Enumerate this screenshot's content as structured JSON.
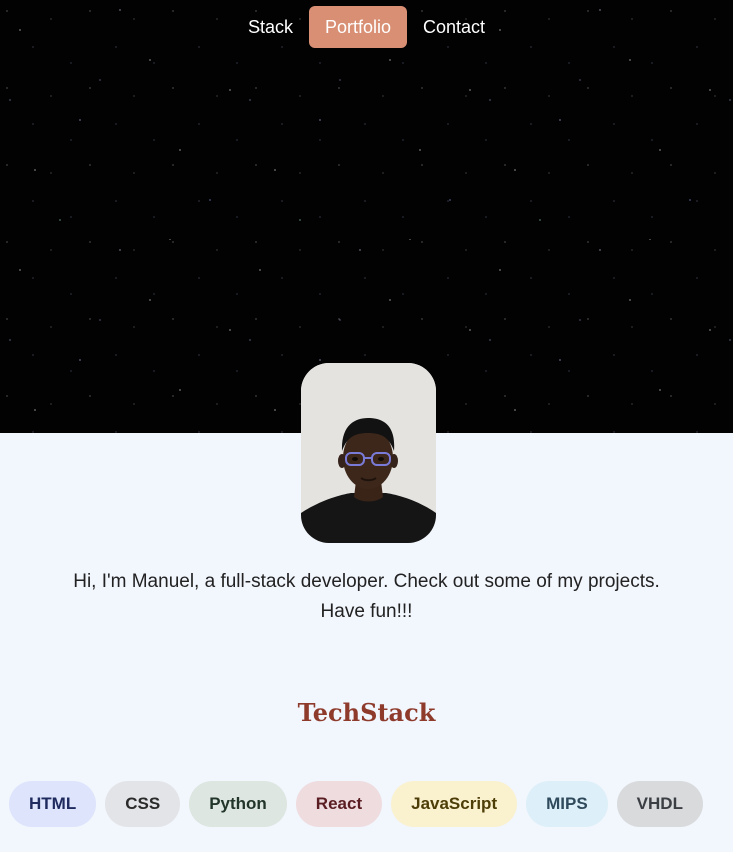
{
  "nav": {
    "items": [
      {
        "label": "Stack",
        "active": false
      },
      {
        "label": "Portfolio",
        "active": true
      },
      {
        "label": "Contact",
        "active": false
      }
    ],
    "active_color": "#d88f74"
  },
  "profile": {
    "intro_line1": "Hi, I'm Manuel, a full-stack developer. Check out some of my projects.",
    "intro_line2": "Have fun!!!"
  },
  "techstack": {
    "title": "TechStack",
    "chips": [
      {
        "label": "HTML",
        "bg": "#dde4fb",
        "fg": "#1f2a5e"
      },
      {
        "label": "CSS",
        "bg": "#e3e4e7",
        "fg": "#2b2b2b"
      },
      {
        "label": "Python",
        "bg": "#dde6e0",
        "fg": "#22352a"
      },
      {
        "label": "React",
        "bg": "#eedcdf",
        "fg": "#5a1e22"
      },
      {
        "label": "JavaScript",
        "bg": "#faf1cf",
        "fg": "#4d3d07"
      },
      {
        "label": "MIPS",
        "bg": "#ddeff8",
        "fg": "#2f4a5c"
      },
      {
        "label": "VHDL",
        "bg": "#d8dadc",
        "fg": "#3b3f44"
      }
    ]
  }
}
